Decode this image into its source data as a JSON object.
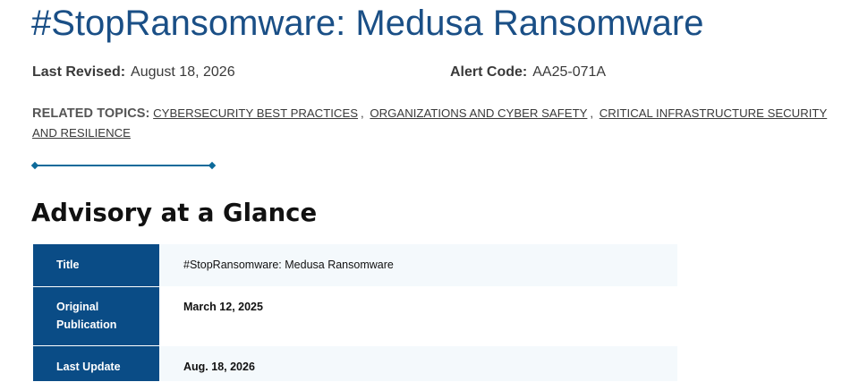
{
  "page": {
    "title": "#StopRansomware: Medusa Ransomware"
  },
  "meta": {
    "last_revised_label": "Last Revised:",
    "last_revised_value": "August 18, 2026",
    "alert_code_label": "Alert Code:",
    "alert_code_value": "AA25-071A"
  },
  "related_topics": {
    "label": "RELATED TOPICS:",
    "items": [
      "CYBERSECURITY BEST PRACTICES",
      "ORGANIZATIONS AND CYBER SAFETY",
      "CRITICAL INFRASTRUCTURE SECURITY AND RESILIENCE"
    ],
    "separator": ","
  },
  "colors": {
    "title": "#1a4f86",
    "table_header_bg": "#0a4c86",
    "divider": "#0c6a9a"
  },
  "glance": {
    "heading": "Advisory at a Glance",
    "rows": [
      {
        "label": "Title",
        "value": "#StopRansomware: Medusa Ransomware"
      },
      {
        "label": "Original Publication",
        "value": "March 12, 2025"
      },
      {
        "label": "Last Update",
        "value": "Aug. 18, 2026"
      }
    ]
  }
}
